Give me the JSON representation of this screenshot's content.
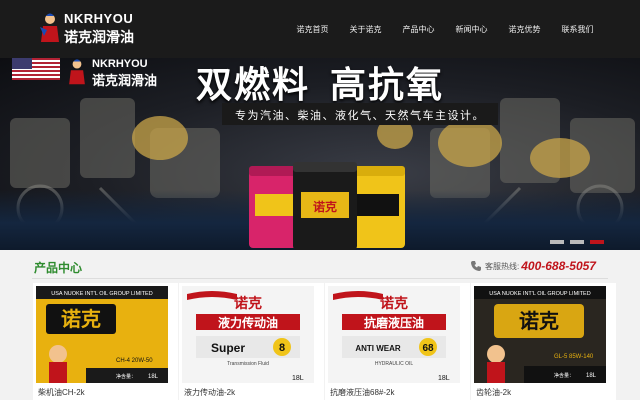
{
  "header": {
    "logo_en": "NKRHYOU",
    "logo_cn": "诺克润滑油",
    "nav": [
      "诺克首页",
      "关于诺克",
      "产品中心",
      "新闻中心",
      "诺克优势",
      "联系我们"
    ]
  },
  "banner": {
    "logo_en": "NKRHYOU",
    "logo_cn": "诺克润滑油",
    "headline_left": "双燃料",
    "headline_right": "高抗氧",
    "subline": "专为汽油、柴油、液化气、天然气车主设计。",
    "slides": 3,
    "active_slide": 3
  },
  "products": {
    "title": "产品中心",
    "hotline_label": "客服热线:",
    "hotline_number": "400-688-5057",
    "items": [
      {
        "name": "柴机油CH-2k",
        "brand": "诺克",
        "banner": "USA NUOKE INT'L OIL GROUP LIMITED",
        "spec": "CH-4  20W-50",
        "note": "净含量：",
        "vol": "18L"
      },
      {
        "name": "液力传动油-2k",
        "brand": "诺克",
        "product": "液力传动油",
        "word": "Super",
        "num": "8",
        "sub": "Transmission Fluid",
        "vol": "18L"
      },
      {
        "name": "抗磨液压油68#-2k",
        "brand": "诺克",
        "product": "抗磨液压油",
        "word": "ANTI WEAR",
        "num": "68",
        "sub": "HYDRAULIC OIL",
        "vol": "18L"
      },
      {
        "name": "齿轮油-2k",
        "brand": "诺克",
        "banner": "USA NUOKE INT'L OIL GROUP LIMITED",
        "spec": "GL-5  85W-140",
        "note": "净含量：",
        "vol": "18L"
      }
    ]
  },
  "colors": {
    "accent_red": "#c0141b",
    "accent_green": "#2e8b2e",
    "header_bg": "#1b1b1b"
  }
}
